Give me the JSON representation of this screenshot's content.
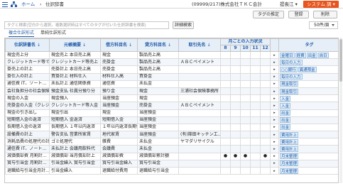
{
  "header": {
    "breadcrumb": {
      "home": "ホーム",
      "separator": "›",
      "current": "仕訳辞書"
    },
    "company": "(09999/217)株式会社ＴＫＣ会計",
    "user": "提喪江 ▾",
    "system_menu": "システム 調 ▾"
  },
  "toolbar": {
    "tag_settings": "タグの推定",
    "register": "登録",
    "delete": "削除",
    "search_placeholder": "タグと検索(空白から選択。複数選択時はすべてのタグが付いた仕訳辞書を検索)",
    "detail_search": "詳細検索",
    "page_size": "50件/頁"
  },
  "tabs": [
    {
      "label": "複合仕訳形式"
    },
    {
      "label": "単純仕訳形式"
    }
  ],
  "table": {
    "headers": {
      "name": "仕訳辞書名",
      "description": "元帳摘要",
      "debit": "借方科目名",
      "credit": "貸方科目名",
      "partner": "取引先名",
      "months_group": "月ごとの入力状況",
      "tags": "タグ",
      "months": [
        "8",
        "9",
        "10",
        "11",
        "12"
      ]
    },
    "rows": [
      {
        "name": "現金売上分",
        "description": "現金売上 本日売上高",
        "debit": "現金",
        "credit": "製品売上高",
        "partner": "",
        "marks": [
          "",
          "",
          "",
          "",
          ""
        ],
        "tags": [
          "金曜日",
          "経費",
          "出金",
          "自日"
        ]
      },
      {
        "name": "クレジットカード等で",
        "description": "クレジットカード等売上",
        "debit": "売掛金",
        "credit": "製品売上高",
        "partner": "ＡＢＣペイメント",
        "marks": [
          "",
          "",
          "",
          "",
          ""
        ],
        "tags": [
          "毎日の入力"
        ]
      },
      {
        "name": "掛売上の計上",
        "description": "売掛計上 本日売上高",
        "debit": "売掛金",
        "credit": "製品売上高",
        "partner": "",
        "marks": [
          "",
          "",
          "",
          "",
          ""
        ],
        "tags": [
          "○○銀行",
          "異通預金"
        ]
      },
      {
        "name": "掛仕入の計上",
        "description": "買掛計上 材料仕入",
        "debit": "材料仕入高",
        "credit": "買掛金",
        "partner": "",
        "marks": [
          "",
          "",
          "",
          "",
          ""
        ],
        "tags": [
          "毎日の入力"
        ]
      },
      {
        "name": "通信費 IT、ソート…",
        "description": "未払計上 通信関係費",
        "debit": "通信費",
        "credit": "未払金",
        "partner": "",
        "marks": [
          "",
          "",
          "",
          "",
          ""
        ],
        "tags": [
          "現金取引"
        ]
      },
      {
        "name": "会社負担分の社会保険",
        "description": "預金支払 社員分預り分",
        "debit": "預り金",
        "credit": "現金",
        "partner": "三浦社会保険事務所",
        "marks": [
          "",
          "",
          "",
          "",
          ""
        ],
        "tags": [
          "現金取引"
        ]
      },
      {
        "name": "現金の入金",
        "description": "現金預入",
        "debit": "当座預金",
        "credit": "現金",
        "partner": "",
        "marks": [
          "",
          "",
          "",
          "",
          ""
        ],
        "tags": [
          "入金"
        ]
      },
      {
        "name": "売掛金の入金（クレジ…",
        "description": "クレジットカード等入金",
        "debit": "当座預金",
        "credit": "売掛金",
        "partner": "ＡＢＣペイメント",
        "marks": [
          "",
          "",
          "",
          "",
          ""
        ],
        "tags": [
          "入金"
        ]
      },
      {
        "name": "現金の引き出し",
        "description": "現金引出",
        "debit": "現金",
        "credit": "当座預金",
        "partner": "",
        "marks": [
          "",
          "",
          "",
          "",
          ""
        ],
        "tags": [
          "出金"
        ]
      },
      {
        "name": "短期借入金の返済",
        "description": "短期借入 金返済",
        "debit": "短期借入金",
        "credit": "当座預金",
        "partner": "",
        "marks": [
          "",
          "",
          "",
          "",
          ""
        ],
        "tags": [
          "出金"
        ]
      },
      {
        "name": "長期借入金の返済",
        "description": "長期借入 １年以内返済",
        "debit": "１年以内返済長期借",
        "credit": "当座預金",
        "partner": "",
        "marks": [
          "",
          "",
          "",
          "",
          ""
        ],
        "tags": [
          "出金"
        ]
      },
      {
        "name": "設備費の計上",
        "description": "警告支払 営業所家賃",
        "debit": "地代家賃",
        "credit": "当座預金",
        "partner": "(有)篠田キッチン工…",
        "marks": [
          "",
          "",
          "",
          "",
          ""
        ],
        "tags": [
          "費用計上"
        ]
      },
      {
        "name": "消耗品費の処理代の計上",
        "description": "ゴミ処理代",
        "debit": "雑費",
        "credit": "未払金",
        "partner": "ヤマダリサイクル",
        "marks": [
          "",
          "",
          "",
          "",
          ""
        ],
        "tags": [
          "費用計上"
        ]
      },
      {
        "name": "通信費 IT、ノート…",
        "description": "未払計上 会議用飲料代",
        "debit": "会議費",
        "credit": "未払金",
        "partner": "",
        "marks": [
          "",
          "",
          "",
          "",
          ""
        ],
        "tags": [
          "費用計上"
        ]
      },
      {
        "name": "減価償却費 月割計…",
        "description": "減価償却 当月償却計上",
        "debit": "減価償却費",
        "credit": "減価償却累計額",
        "partner": "",
        "marks": [
          "●",
          "●",
          "●",
          "",
          "●"
        ],
        "tags": [
          "月末整理"
        ]
      },
      {
        "name": "賞与引当金 月割計…",
        "description": "引当金繰入 賞与引当金",
        "debit": "賞与引当金繰入",
        "credit": "賞与引当金",
        "partner": "",
        "marks": [
          "",
          "",
          "",
          "",
          ""
        ],
        "tags": [
          "月末整理"
        ]
      },
      {
        "name": "退職給与引当金月計…",
        "description": "引当金繰入",
        "debit": "退職給付費用",
        "credit": "退職給与引当金",
        "partner": "",
        "marks": [
          "",
          "",
          "",
          "",
          ""
        ],
        "tags": [
          "月末整理"
        ]
      }
    ]
  }
}
